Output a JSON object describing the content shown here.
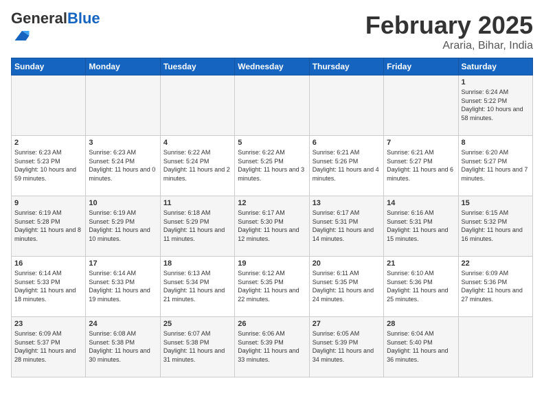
{
  "header": {
    "logo_general": "General",
    "logo_blue": "Blue",
    "title": "February 2025",
    "subtitle": "Araria, Bihar, India"
  },
  "calendar": {
    "days_of_week": [
      "Sunday",
      "Monday",
      "Tuesday",
      "Wednesday",
      "Thursday",
      "Friday",
      "Saturday"
    ],
    "weeks": [
      [
        {
          "day": "",
          "info": ""
        },
        {
          "day": "",
          "info": ""
        },
        {
          "day": "",
          "info": ""
        },
        {
          "day": "",
          "info": ""
        },
        {
          "day": "",
          "info": ""
        },
        {
          "day": "",
          "info": ""
        },
        {
          "day": "1",
          "info": "Sunrise: 6:24 AM\nSunset: 5:22 PM\nDaylight: 10 hours and 58 minutes."
        }
      ],
      [
        {
          "day": "2",
          "info": "Sunrise: 6:23 AM\nSunset: 5:23 PM\nDaylight: 10 hours and 59 minutes."
        },
        {
          "day": "3",
          "info": "Sunrise: 6:23 AM\nSunset: 5:24 PM\nDaylight: 11 hours and 0 minutes."
        },
        {
          "day": "4",
          "info": "Sunrise: 6:22 AM\nSunset: 5:24 PM\nDaylight: 11 hours and 2 minutes."
        },
        {
          "day": "5",
          "info": "Sunrise: 6:22 AM\nSunset: 5:25 PM\nDaylight: 11 hours and 3 minutes."
        },
        {
          "day": "6",
          "info": "Sunrise: 6:21 AM\nSunset: 5:26 PM\nDaylight: 11 hours and 4 minutes."
        },
        {
          "day": "7",
          "info": "Sunrise: 6:21 AM\nSunset: 5:27 PM\nDaylight: 11 hours and 6 minutes."
        },
        {
          "day": "8",
          "info": "Sunrise: 6:20 AM\nSunset: 5:27 PM\nDaylight: 11 hours and 7 minutes."
        }
      ],
      [
        {
          "day": "9",
          "info": "Sunrise: 6:19 AM\nSunset: 5:28 PM\nDaylight: 11 hours and 8 minutes."
        },
        {
          "day": "10",
          "info": "Sunrise: 6:19 AM\nSunset: 5:29 PM\nDaylight: 11 hours and 10 minutes."
        },
        {
          "day": "11",
          "info": "Sunrise: 6:18 AM\nSunset: 5:29 PM\nDaylight: 11 hours and 11 minutes."
        },
        {
          "day": "12",
          "info": "Sunrise: 6:17 AM\nSunset: 5:30 PM\nDaylight: 11 hours and 12 minutes."
        },
        {
          "day": "13",
          "info": "Sunrise: 6:17 AM\nSunset: 5:31 PM\nDaylight: 11 hours and 14 minutes."
        },
        {
          "day": "14",
          "info": "Sunrise: 6:16 AM\nSunset: 5:31 PM\nDaylight: 11 hours and 15 minutes."
        },
        {
          "day": "15",
          "info": "Sunrise: 6:15 AM\nSunset: 5:32 PM\nDaylight: 11 hours and 16 minutes."
        }
      ],
      [
        {
          "day": "16",
          "info": "Sunrise: 6:14 AM\nSunset: 5:33 PM\nDaylight: 11 hours and 18 minutes."
        },
        {
          "day": "17",
          "info": "Sunrise: 6:14 AM\nSunset: 5:33 PM\nDaylight: 11 hours and 19 minutes."
        },
        {
          "day": "18",
          "info": "Sunrise: 6:13 AM\nSunset: 5:34 PM\nDaylight: 11 hours and 21 minutes."
        },
        {
          "day": "19",
          "info": "Sunrise: 6:12 AM\nSunset: 5:35 PM\nDaylight: 11 hours and 22 minutes."
        },
        {
          "day": "20",
          "info": "Sunrise: 6:11 AM\nSunset: 5:35 PM\nDaylight: 11 hours and 24 minutes."
        },
        {
          "day": "21",
          "info": "Sunrise: 6:10 AM\nSunset: 5:36 PM\nDaylight: 11 hours and 25 minutes."
        },
        {
          "day": "22",
          "info": "Sunrise: 6:09 AM\nSunset: 5:36 PM\nDaylight: 11 hours and 27 minutes."
        }
      ],
      [
        {
          "day": "23",
          "info": "Sunrise: 6:09 AM\nSunset: 5:37 PM\nDaylight: 11 hours and 28 minutes."
        },
        {
          "day": "24",
          "info": "Sunrise: 6:08 AM\nSunset: 5:38 PM\nDaylight: 11 hours and 30 minutes."
        },
        {
          "day": "25",
          "info": "Sunrise: 6:07 AM\nSunset: 5:38 PM\nDaylight: 11 hours and 31 minutes."
        },
        {
          "day": "26",
          "info": "Sunrise: 6:06 AM\nSunset: 5:39 PM\nDaylight: 11 hours and 33 minutes."
        },
        {
          "day": "27",
          "info": "Sunrise: 6:05 AM\nSunset: 5:39 PM\nDaylight: 11 hours and 34 minutes."
        },
        {
          "day": "28",
          "info": "Sunrise: 6:04 AM\nSunset: 5:40 PM\nDaylight: 11 hours and 36 minutes."
        },
        {
          "day": "",
          "info": ""
        }
      ]
    ]
  }
}
